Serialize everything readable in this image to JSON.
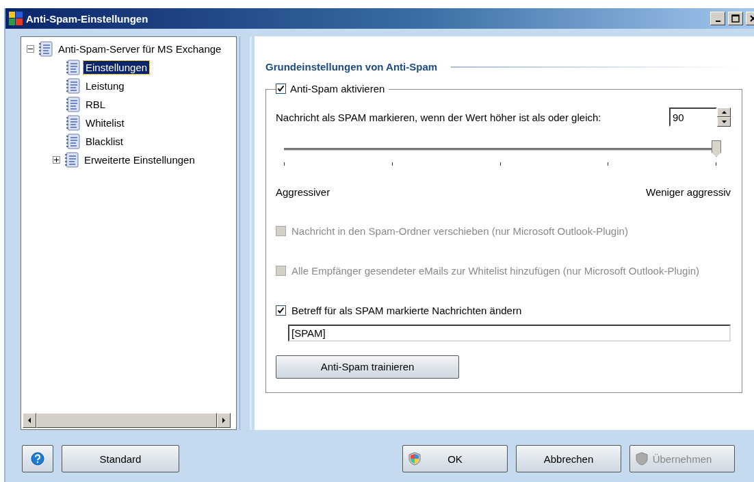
{
  "window": {
    "title": "Anti-Spam-Einstellungen"
  },
  "tree": [
    {
      "label": "Anti-Spam-Server für MS Exchange",
      "expanded": true,
      "selected": false,
      "children": [
        {
          "label": "Einstellungen",
          "selected": true
        },
        {
          "label": "Leistung",
          "selected": false
        },
        {
          "label": "RBL",
          "selected": false
        },
        {
          "label": "Whitelist",
          "selected": false
        },
        {
          "label": "Blacklist",
          "selected": false
        },
        {
          "label": "Erweiterte Einstellungen",
          "selected": false,
          "expanded": false
        }
      ]
    }
  ],
  "section": {
    "title": "Grundeinstellungen von Anti-Spam",
    "group": {
      "label": "Anti-Spam aktivieren",
      "checked": true
    },
    "threshold": {
      "label": "Nachricht als SPAM markieren, wenn der Wert höher ist als oder gleich:",
      "value": "90"
    },
    "slider": {
      "level": 1,
      "min_label": "Aggressiver",
      "max_label": "Weniger aggressiv"
    },
    "options": [
      {
        "label": "Nachricht in den Spam-Ordner verschieben (nur Microsoft Outlook-Plugin)",
        "checked": false,
        "disabled": true
      },
      {
        "label": "Alle Empfänger gesendeter eMails zur Whitelist hinzufügen (nur Microsoft Outlook-Plugin)",
        "checked": false,
        "disabled": true
      },
      {
        "label": "Betreff für als SPAM markierte Nachrichten ändern",
        "checked": true,
        "disabled": false
      }
    ],
    "subject": {
      "value": "[SPAM]"
    },
    "train_button": "Anti-Spam trainieren"
  },
  "footer": {
    "left": [
      {
        "kind": "help"
      },
      {
        "kind": "text",
        "label": "Standard"
      }
    ],
    "right": [
      {
        "kind": "shield",
        "label": "OK",
        "disabled": false
      },
      {
        "kind": "text",
        "label": "Abbrechen",
        "disabled": false
      },
      {
        "kind": "shield",
        "label": "Übernehmen",
        "disabled": true
      }
    ]
  }
}
